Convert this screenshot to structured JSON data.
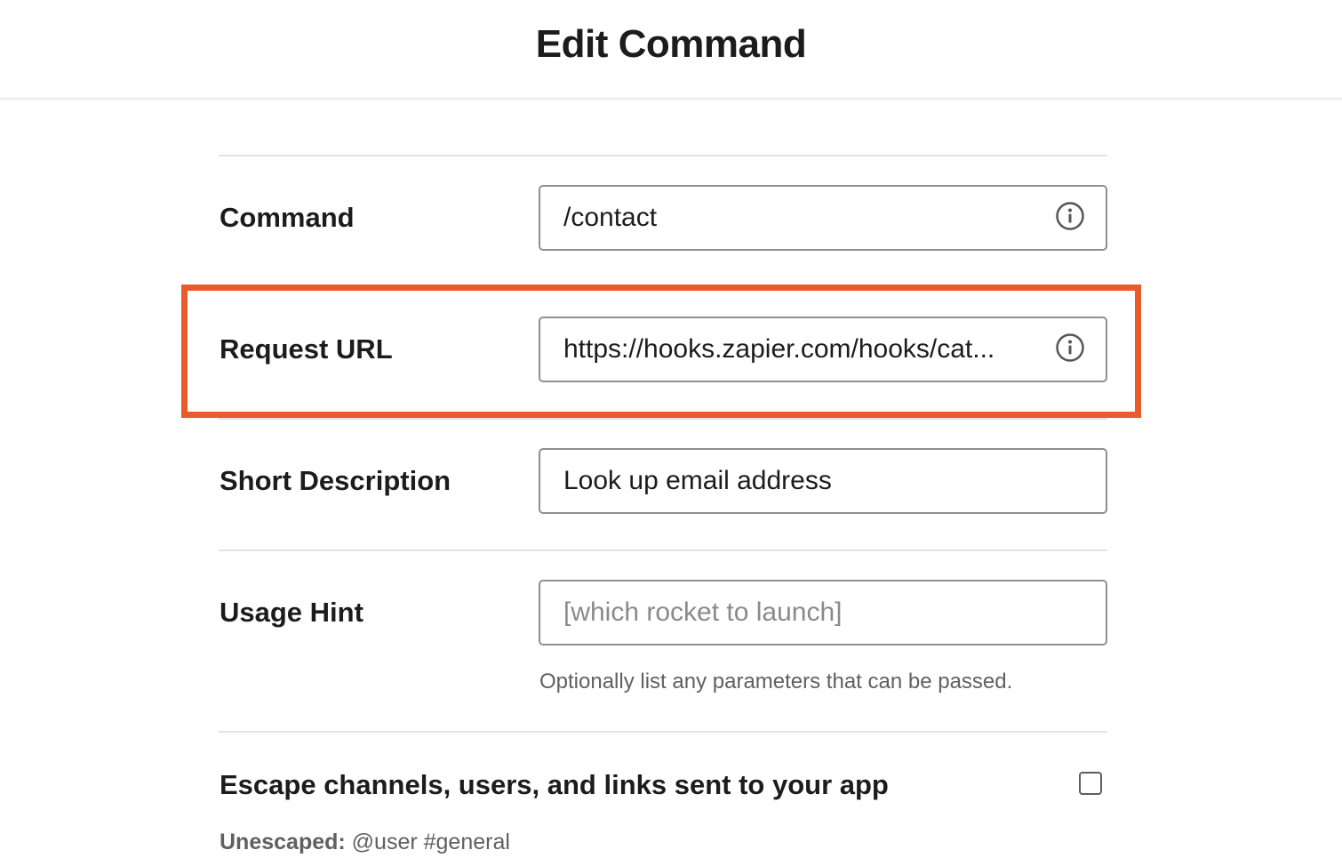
{
  "header": {
    "title": "Edit Command"
  },
  "form": {
    "command": {
      "label": "Command",
      "value": "/contact"
    },
    "request_url": {
      "label": "Request URL",
      "value": "https://hooks.zapier.com/hooks/cat..."
    },
    "short_description": {
      "label": "Short Description",
      "value": "Look up email address"
    },
    "usage_hint": {
      "label": "Usage Hint",
      "value": "",
      "placeholder": "[which rocket to launch]",
      "help": "Optionally list any parameters that can be passed."
    },
    "escape": {
      "label": "Escape channels, users, and links sent to your app",
      "checked": false,
      "unescaped_label": "Unescaped:",
      "unescaped_example": "@user #general"
    }
  },
  "colors": {
    "highlight": "#e95b2a",
    "border": "#8f8f8f",
    "text": "#1d1c1d",
    "muted": "#616061"
  },
  "icons": {
    "info": "info-circle-icon"
  }
}
